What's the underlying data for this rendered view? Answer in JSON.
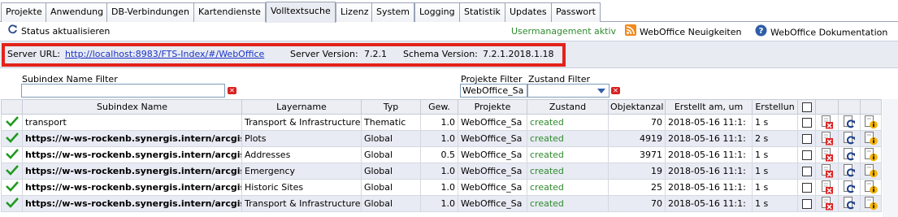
{
  "tabs": [
    "Projekte",
    "Anwendung",
    "DB-Verbindungen",
    "Kartendienste",
    "Volltextsuche",
    "Lizenz",
    "System",
    "Logging",
    "Statistik",
    "Updates",
    "Passwort"
  ],
  "active_tab": "Volltextsuche",
  "toolbar": {
    "refresh_label": "Status aktualisieren",
    "usermanagement": "Usermanagement aktiv",
    "news_label": "WebOffice Neuigkeiten",
    "docs_label": "WebOffice Dokumentation"
  },
  "server": {
    "url_label": "Server URL:",
    "url": "http://localhost:8983/FTS-Index/#/WebOffice",
    "version_label": "Server Version:",
    "version": "7.2.1",
    "schema_label": "Schema Version:",
    "schema": "7.2.1.2018.1.18"
  },
  "filters": {
    "subindex_label": "Subindex Name Filter",
    "subindex_value": "",
    "projekte_label": "Projekte Filter",
    "projekte_value": "WebOffice_Sa",
    "zustand_label": "Zustand Filter",
    "zustand_value": ""
  },
  "columns": [
    "Subindex Name",
    "Layername",
    "Typ",
    "Gew.",
    "Projekte",
    "Zustand",
    "Objektanzal",
    "Erstellt am, um",
    "Erstellun"
  ],
  "rows": [
    {
      "name": "transport",
      "bold": false,
      "layer": "Transport & Infrastructure",
      "typ": "Thematic",
      "gew": "1.0",
      "projekte": "WebOffice_Sa",
      "zustand": "created",
      "objekte": "70",
      "erstellt": "2018-05-16 11:1:",
      "dauer": "1 s"
    },
    {
      "name": "https://w-ws-rockenb.synergis.intern/arcgis",
      "bold": true,
      "layer": "Plots",
      "typ": "Global",
      "gew": "1.0",
      "projekte": "WebOffice_Sa",
      "zustand": "created",
      "objekte": "4919",
      "erstellt": "2018-05-16 11:1:",
      "dauer": "2 s"
    },
    {
      "name": "https://w-ws-rockenb.synergis.intern/arcgis",
      "bold": true,
      "layer": "Addresses",
      "typ": "Global",
      "gew": "0.5",
      "projekte": "WebOffice_Sa",
      "zustand": "created",
      "objekte": "3971",
      "erstellt": "2018-05-16 11:1:",
      "dauer": "1 s"
    },
    {
      "name": "https://w-ws-rockenb.synergis.intern/arcgis",
      "bold": true,
      "layer": "Emergency",
      "typ": "Global",
      "gew": "1.0",
      "projekte": "WebOffice_Sa",
      "zustand": "created",
      "objekte": "19",
      "erstellt": "2018-05-16 11:1:",
      "dauer": "1 s"
    },
    {
      "name": "https://w-ws-rockenb.synergis.intern/arcgis",
      "bold": true,
      "layer": "Historic Sites",
      "typ": "Global",
      "gew": "1.0",
      "projekte": "WebOffice_Sa",
      "zustand": "created",
      "objekte": "25",
      "erstellt": "2018-05-16 11:1:",
      "dauer": "1 s"
    },
    {
      "name": "https://w-ws-rockenb.synergis.intern/arcgis",
      "bold": true,
      "layer": "Transport & Infrastructure",
      "typ": "Global",
      "gew": "1.0",
      "projekte": "WebOffice_Sa",
      "zustand": "created",
      "objekte": "70",
      "erstellt": "2018-05-16 11:1:",
      "dauer": "1 s"
    }
  ],
  "colors": {
    "status_green": "#2e8b2e",
    "link_blue": "#1a32c8",
    "highlight_red": "#e2231a"
  }
}
